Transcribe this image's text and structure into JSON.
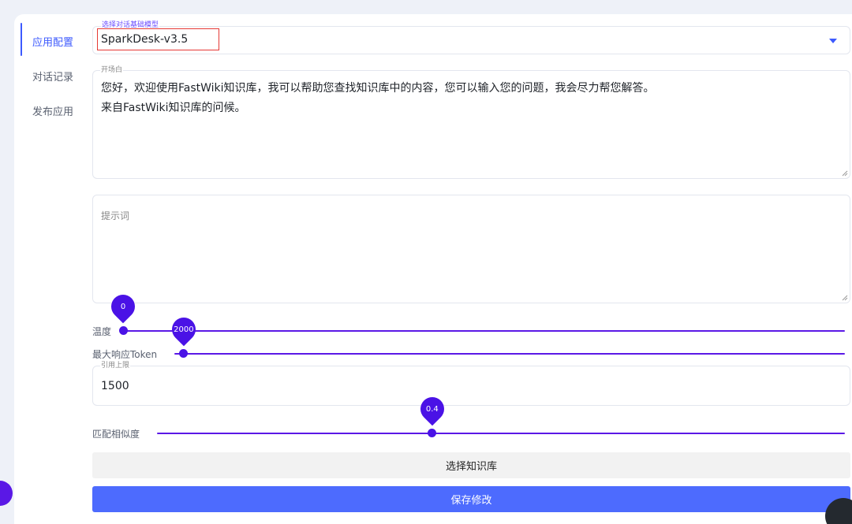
{
  "sidebar": {
    "items": [
      {
        "label": "应用配置"
      },
      {
        "label": "对话记录"
      },
      {
        "label": "发布应用"
      }
    ]
  },
  "model_select": {
    "legend": "选择对话基础模型",
    "value": "SparkDesk-v3.5"
  },
  "opening": {
    "legend": "开场白",
    "text": "您好，欢迎使用FastWiki知识库，我可以帮助您查找知识库中的内容，您可以输入您的问题，我会尽力帮您解答。\n来自FastWiki知识库的问候。"
  },
  "prompt": {
    "placeholder": "提示词"
  },
  "temperature": {
    "label": "温度",
    "value": "0",
    "fraction": 0
  },
  "max_tokens": {
    "label": "最大响应Token",
    "value": "2000",
    "fraction": 0.014
  },
  "quote_limit": {
    "legend": "引用上限",
    "value": "1500"
  },
  "similarity": {
    "label": "匹配相似度",
    "value": "0.4",
    "fraction": 0.4
  },
  "buttons": {
    "select_kb": "选择知识库",
    "save": "保存修改"
  },
  "colors": {
    "accent": "#3d5afe",
    "slider": "#5a18e6",
    "save_button": "#4d6bfe"
  }
}
